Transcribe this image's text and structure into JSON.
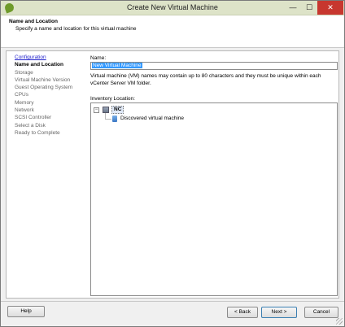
{
  "window": {
    "title": "Create New Virtual Machine",
    "minimize_glyph": "—",
    "maximize_glyph": "☐",
    "close_glyph": "✕"
  },
  "header": {
    "title": "Name and Location",
    "subtitle": "Specify a name and location for this virtual machine"
  },
  "nav": {
    "items": [
      {
        "label": "Configuration",
        "state": "link"
      },
      {
        "label": "Name and Location",
        "state": "current"
      },
      {
        "label": "Storage",
        "state": "pending"
      },
      {
        "label": "Virtual Machine Version",
        "state": "pending"
      },
      {
        "label": "Guest Operating System",
        "state": "pending"
      },
      {
        "label": "CPUs",
        "state": "pending"
      },
      {
        "label": "Memory",
        "state": "pending"
      },
      {
        "label": "Network",
        "state": "pending"
      },
      {
        "label": "SCSI Controller",
        "state": "pending"
      },
      {
        "label": "Select a Disk",
        "state": "pending"
      },
      {
        "label": "Ready to Complete",
        "state": "pending"
      }
    ]
  },
  "form": {
    "name_label": "Name:",
    "name_value": "New Virtual Machine",
    "help_text": "Virtual machine (VM) names may contain up to 80 characters and they must be unique within each vCenter Server VM folder.",
    "inventory_label": "Inventory Location:"
  },
  "tree": {
    "expander_glyph": "−",
    "root": {
      "label": "NC",
      "icon": "datacenter-icon"
    },
    "child": {
      "label": "Discovered virtual machine",
      "icon": "folder-icon"
    }
  },
  "buttons": {
    "help": "Help",
    "back": "< Back",
    "next": "Next >",
    "cancel": "Cancel"
  },
  "colors": {
    "titlebar": "#dde3c8",
    "close_button": "#c7372f",
    "selection": "#3399ff",
    "link": "#2222cc"
  }
}
